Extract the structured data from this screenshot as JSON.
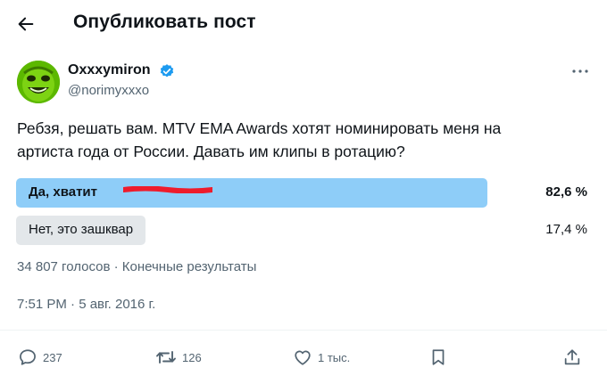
{
  "header": {
    "back_icon": "arrow-left-icon",
    "title": "Опубликовать пост"
  },
  "author": {
    "name": "Oxxxymiron",
    "handle": "@norimyxxxo",
    "verified_icon": "verified-badge-icon",
    "verified_color": "#1d9bf0"
  },
  "tweet": {
    "text": "Ребзя, решать вам. MTV EMA Awards хотят номинировать меня на артиста года от России. Давать им клипы в ротацию?"
  },
  "poll": {
    "options": [
      {
        "label": "Да, хватит",
        "percent_text": "82,6 %",
        "percent": 82.6,
        "winner": true
      },
      {
        "label": "Нет, это зашквар",
        "percent_text": "17,4 %",
        "percent": 17.4,
        "winner": false
      }
    ],
    "meta": "34 807 голосов · Конечные результаты",
    "winner_color": "#8ecdf8",
    "other_color": "#e3e7ea"
  },
  "timestamp": "7:51 PM · 5 авг. 2016 г.",
  "actions": {
    "reply": {
      "icon": "reply-icon",
      "count": "237"
    },
    "retweet": {
      "icon": "retweet-icon",
      "count": "126"
    },
    "like": {
      "icon": "heart-icon",
      "count": "1 тыс."
    },
    "bookmark": {
      "icon": "bookmark-icon"
    },
    "share": {
      "icon": "share-icon"
    }
  }
}
